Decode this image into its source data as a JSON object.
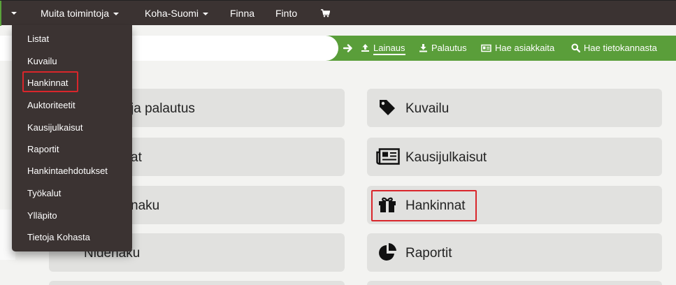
{
  "nav": {
    "more_label": "Muita toimintoja",
    "koha_suomi_label": "Koha-Suomi",
    "finna_label": "Finna",
    "finto_label": "Finto",
    "cart_icon": "cart-icon"
  },
  "search_strip": {
    "input_value": "",
    "links": [
      {
        "label": "Lainaus",
        "icon": "upload-icon"
      },
      {
        "label": "Palautus",
        "icon": "download-icon"
      },
      {
        "label": "Hae asiakkaita",
        "icon": "id-card-icon"
      },
      {
        "label": "Hae tietokannasta",
        "icon": "search-icon"
      }
    ]
  },
  "dropdown": {
    "items": [
      "Listat",
      "Kuvailu",
      "Hankinnat",
      "Auktoriteetit",
      "Kausijulkaisut",
      "Raportit",
      "Hankintaehdotukset",
      "Työkalut",
      "Ylläpito",
      "Tietoja Kohasta"
    ]
  },
  "tiles": {
    "left": [
      {
        "label": "ja palautus"
      },
      {
        "label": "at"
      },
      {
        "label": "naku"
      },
      {
        "label": "Nidehaku"
      }
    ],
    "right": [
      {
        "label": "Kuvailu",
        "icon": "tag-icon"
      },
      {
        "label": "Kausijulkaisut",
        "icon": "newspaper-icon"
      },
      {
        "label": "Hankinnat",
        "icon": "gift-icon"
      },
      {
        "label": "Raportit",
        "icon": "pie-chart-icon"
      }
    ]
  }
}
